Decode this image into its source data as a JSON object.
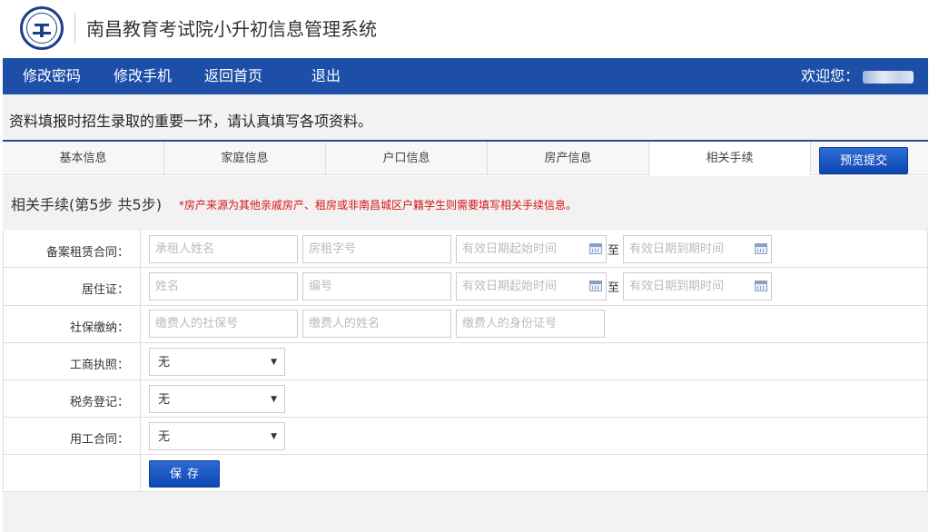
{
  "header": {
    "title": "南昌教育考试院小升初信息管理系统"
  },
  "nav": {
    "items": [
      "修改密码",
      "修改手机",
      "返回首页",
      "退出"
    ],
    "welcome": "欢迎您："
  },
  "notice": "资料填报时招生录取的重要一环，请认真填写各项资料。",
  "tabs": [
    "基本信息",
    "家庭信息",
    "户口信息",
    "房产信息",
    "相关手续"
  ],
  "active_tab": "相关手续",
  "submit_label": "预览提交",
  "step": {
    "title": "相关手续(第5步 共5步)",
    "note": "*房产来源为其他亲戚房产、租房或非南昌城区户籍学生则需要填写相关手续信息。"
  },
  "form": {
    "rental": {
      "label": "备案租赁合同：",
      "placeholders": [
        "承租人姓名",
        "房租字号",
        "有效日期起始时间",
        "有效日期到期时间"
      ],
      "to": "至"
    },
    "residence": {
      "label": "居住证：",
      "placeholders": [
        "姓名",
        "编号",
        "有效日期起始时间",
        "有效日期到期时间"
      ],
      "to": "至"
    },
    "social": {
      "label": "社保缴纳：",
      "placeholders": [
        "缴费人的社保号",
        "缴费人的姓名",
        "缴费人的身份证号"
      ]
    },
    "business": {
      "label": "工商执照：",
      "value": "无"
    },
    "tax": {
      "label": "税务登记：",
      "value": "无"
    },
    "labor": {
      "label": "用工合同：",
      "value": "无"
    },
    "save_label": "保存"
  }
}
